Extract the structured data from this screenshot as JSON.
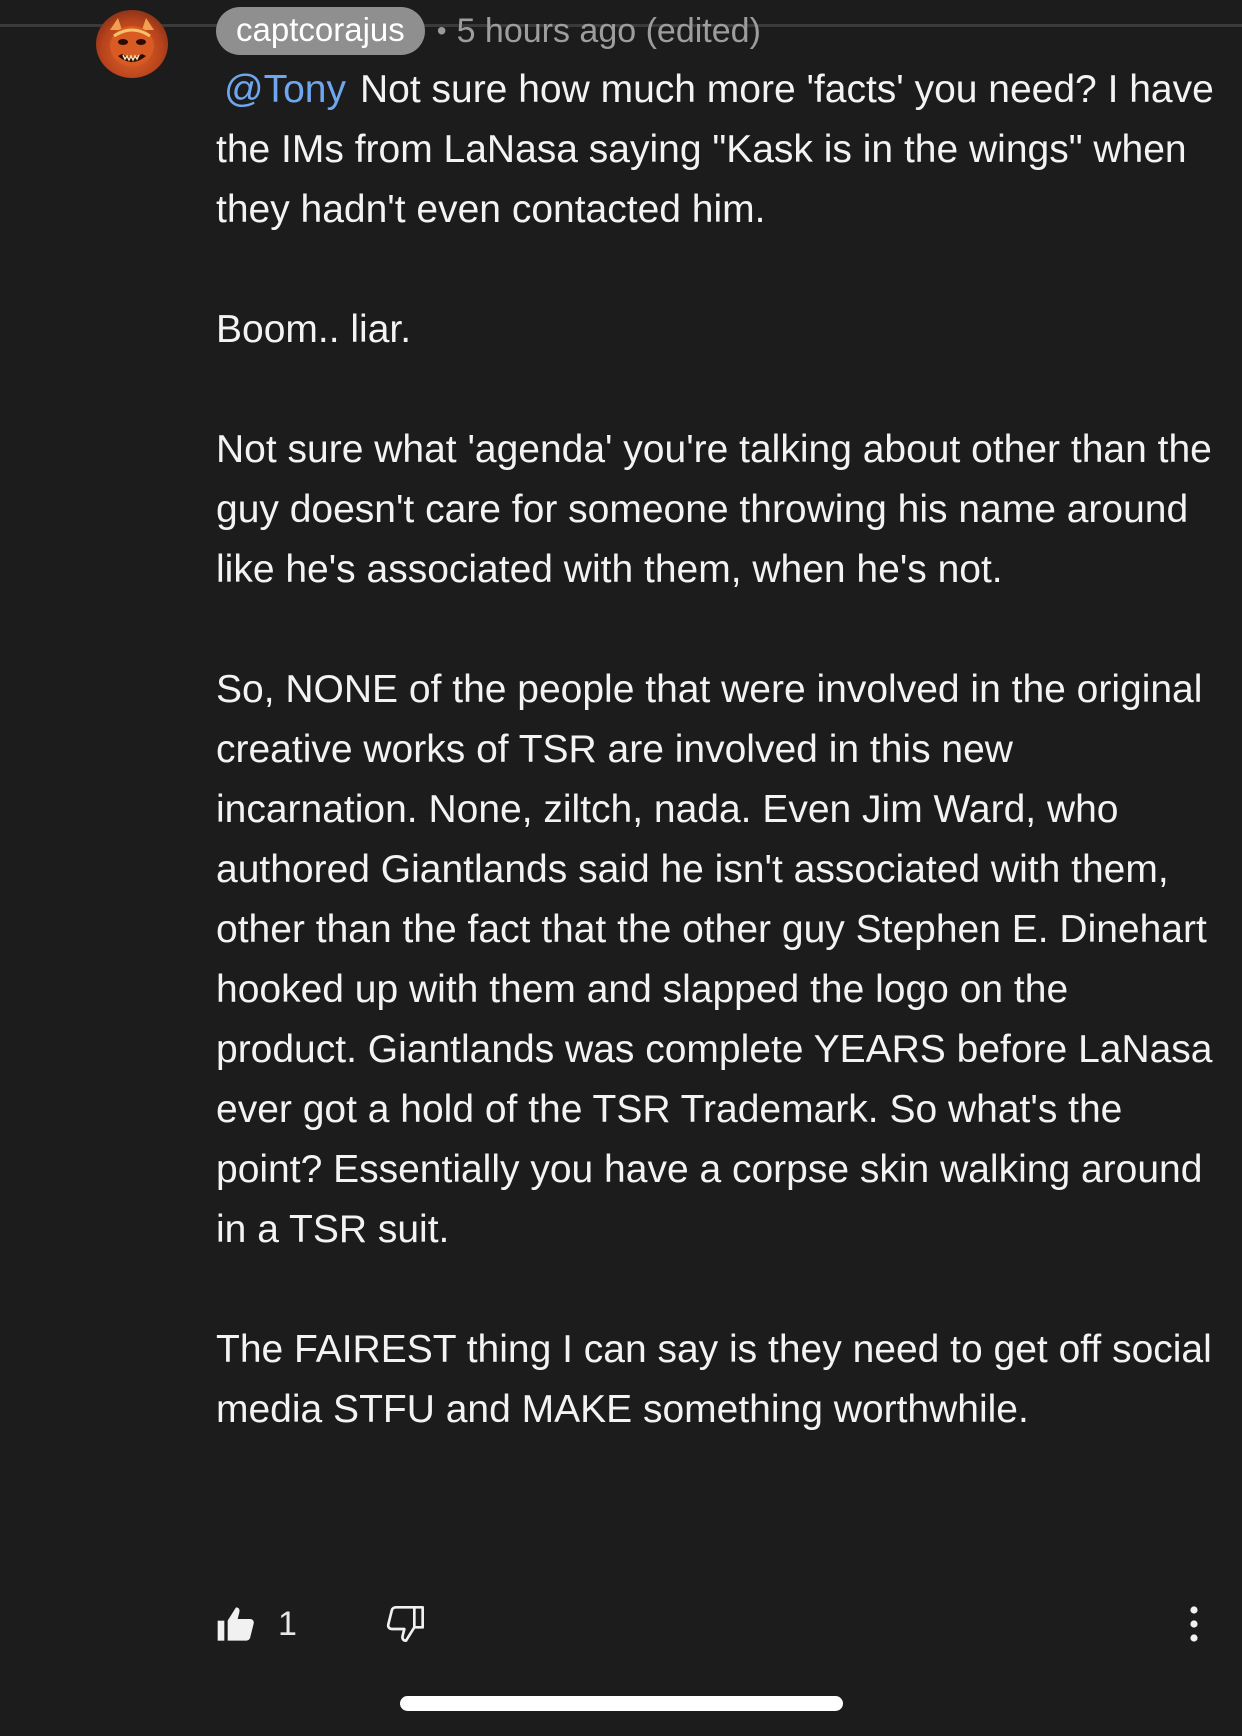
{
  "comment": {
    "author": "captcorajus",
    "separator": "•",
    "timestamp": "5 hours ago (edited)",
    "mention": "@Tony",
    "paragraphs": {
      "p1": "Not sure how much more 'facts' you need? I have the IMs from LaNasa saying \"Kask is in the wings\" when they hadn't even contacted him.",
      "p2": "Boom.. liar.",
      "p3": "Not sure what 'agenda' you're talking about other than the guy doesn't care for someone throwing his name around like he's associated with them, when he's not.",
      "p4": "So, NONE of the people that were involved in the original creative works of TSR are involved in this new incarnation. None, ziltch, nada. Even Jim Ward, who authored Giantlands said he isn't associated with them, other than the fact that the other guy Stephen E. Dinehart hooked up with them and slapped the logo on the product. Giantlands was complete YEARS before LaNasa ever got a hold of the TSR Trademark. So what's the point? Essentially you have a corpse skin walking around in a TSR suit.",
      "p5": "The FAIREST thing I can say is they need to get off social media STFU and MAKE something worthwhile."
    }
  },
  "actions": {
    "like_icon": "thumbs-up-icon",
    "like_count": "1",
    "dislike_icon": "thumbs-down-icon",
    "more_icon": "more-vertical-icon"
  },
  "colors": {
    "background": "#1c1c1d",
    "mention": "#6fa6f0",
    "author_chip": "#8f8f90"
  }
}
